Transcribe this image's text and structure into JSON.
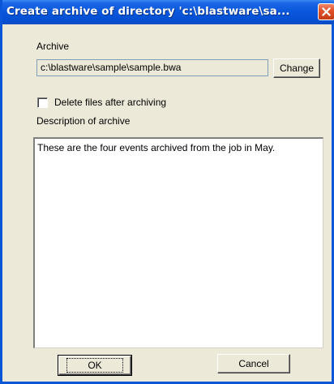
{
  "window": {
    "title": "Create archive of directory 'c:\\blastware\\sa..."
  },
  "archive": {
    "label": "Archive",
    "path": "c:\\blastware\\sample\\sample.bwa",
    "change_label": "Change"
  },
  "options": {
    "delete_files_label": "Delete files after archiving",
    "delete_files_checked": false
  },
  "description": {
    "label": "Description of archive",
    "text": "These are the four events archived from the job in May."
  },
  "buttons": {
    "ok_label": "OK",
    "cancel_label": "Cancel"
  },
  "colors": {
    "titlebar": "#0a58dc",
    "dialog_bg": "#ece9d8",
    "close_button": "#e2532d"
  },
  "icons": {
    "close": "close-icon"
  }
}
